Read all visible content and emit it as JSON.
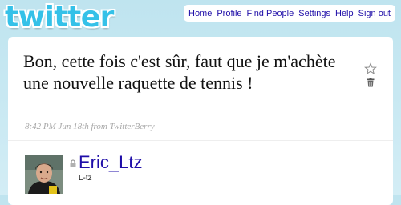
{
  "logo": {
    "text": "twitter"
  },
  "nav": {
    "items": [
      {
        "label": "Home"
      },
      {
        "label": "Profile"
      },
      {
        "label": "Find People"
      },
      {
        "label": "Settings"
      },
      {
        "label": "Help"
      },
      {
        "label": "Sign out"
      }
    ]
  },
  "status": {
    "text": "Bon, cette fois c'est sûr, faut que je m'achète une nouvelle raquette de tennis !",
    "time": "8:42 PM Jun 18th",
    "source_prefix": "from",
    "source": "TwitterBerry"
  },
  "actions": {
    "favorite_icon": "star-icon",
    "delete_icon": "trash-icon"
  },
  "author": {
    "screen_name": "Eric_Ltz",
    "full_name": "L-tz",
    "protected_icon": "lock-icon"
  },
  "colors": {
    "link": "#1f0ea8",
    "logo": "#35c1e8",
    "background": "#c7e8f2",
    "meta": "#a8a8a8"
  }
}
